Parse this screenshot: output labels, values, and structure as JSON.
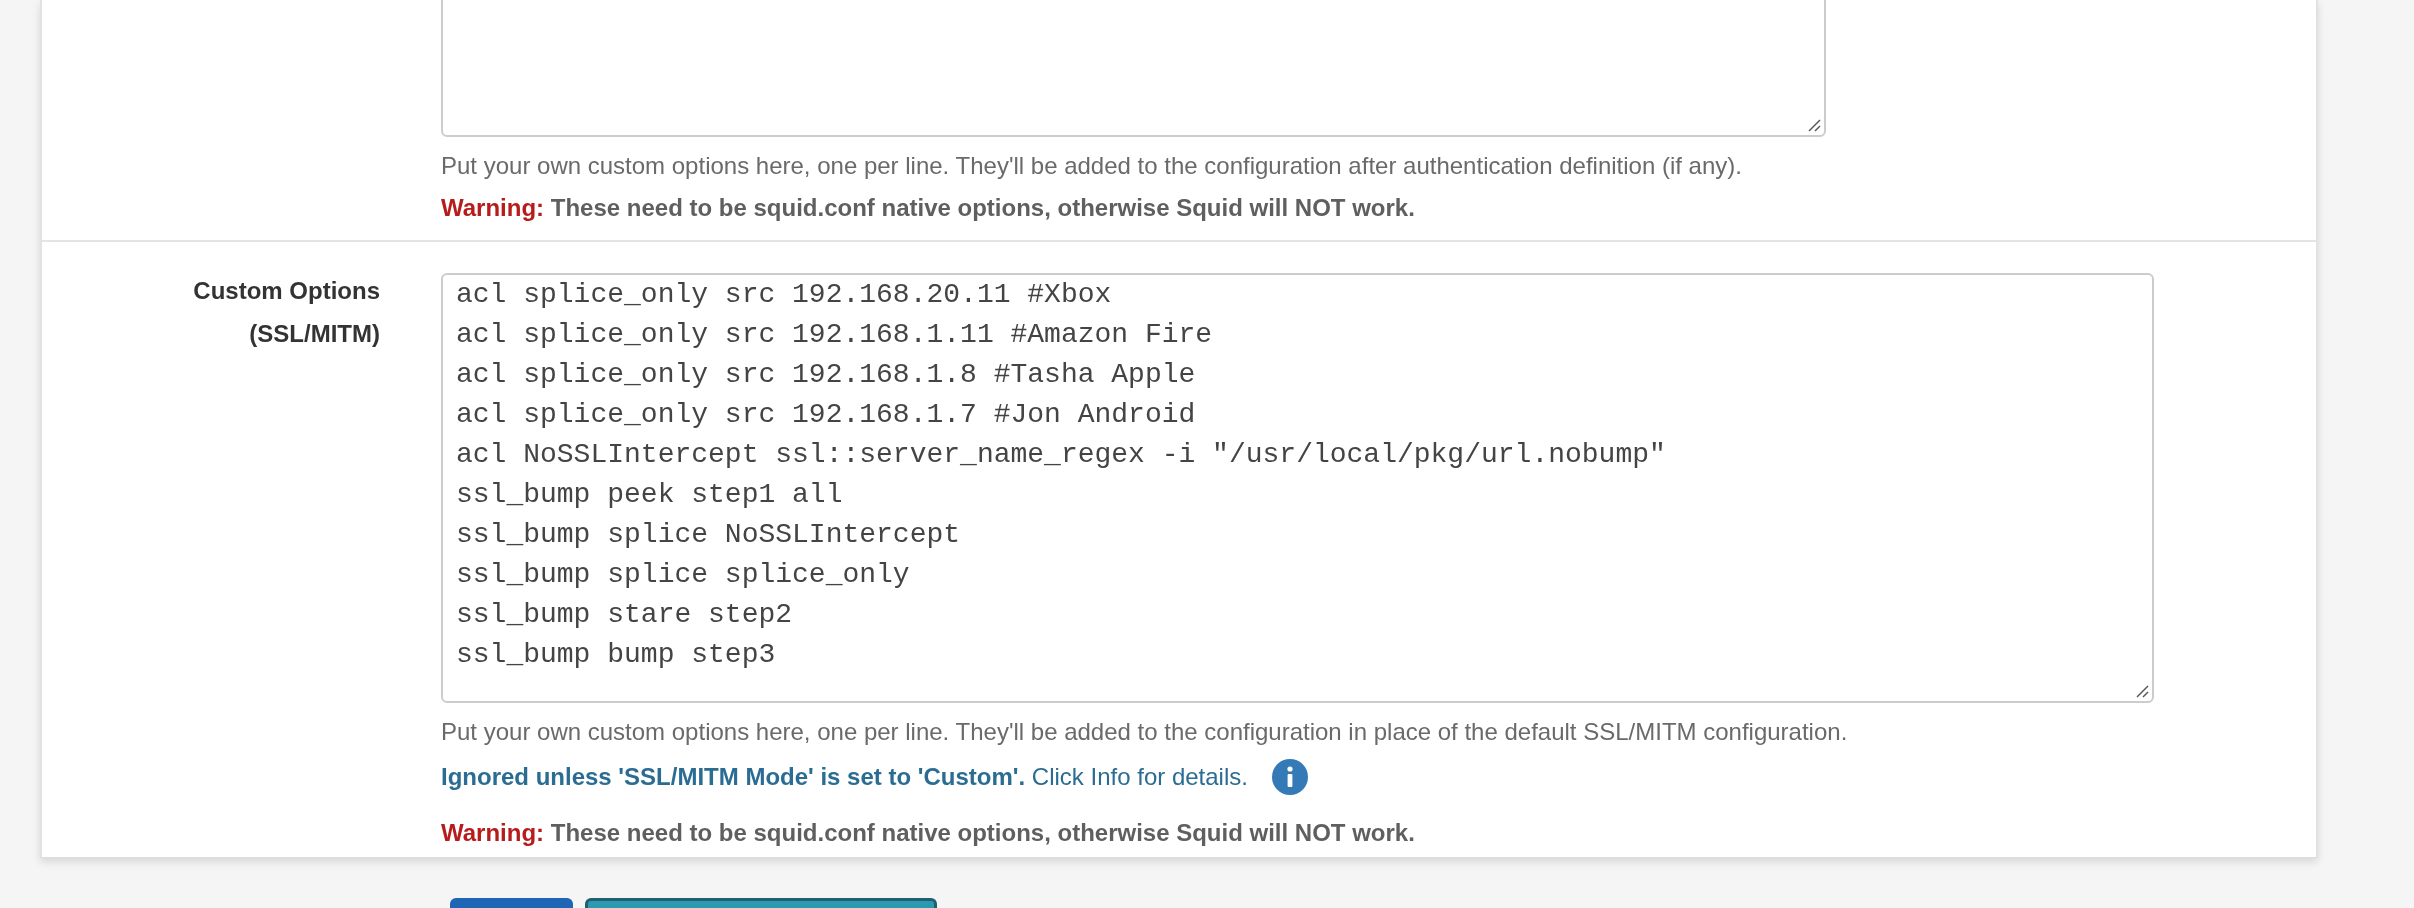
{
  "sections": [
    {
      "help": "Put your own custom options here, one per line. They'll be added to the configuration after authentication definition (if any).",
      "warning": {
        "label": "Warning:",
        "text": "These need to be squid.conf native options, otherwise Squid will NOT work."
      }
    },
    {
      "label": "Custom Options (SSL/MITM)",
      "value": "acl splice_only src 192.168.20.11 #Xbox\nacl splice_only src 192.168.1.11 #Amazon Fire\nacl splice_only src 192.168.1.8 #Tasha Apple\nacl splice_only src 192.168.1.7 #Jon Android\nacl NoSSLIntercept ssl::server_name_regex -i \"/usr/local/pkg/url.nobump\"\nssl_bump peek step1 all\nssl_bump splice NoSSLIntercept\nssl_bump splice splice_only\nssl_bump stare step2\nssl_bump bump step3",
      "help": "Put your own custom options here, one per line. They'll be added to the configuration in place of the default SSL/MITM configuration.",
      "note": "**Ignored unless 'SSL/MITM Mode' is set to 'Custom'.** Click Info for details.",
      "warning": {
        "label": "Warning:",
        "text": "These need to be squid.conf native options, otherwise Squid will NOT work."
      }
    }
  ]
}
